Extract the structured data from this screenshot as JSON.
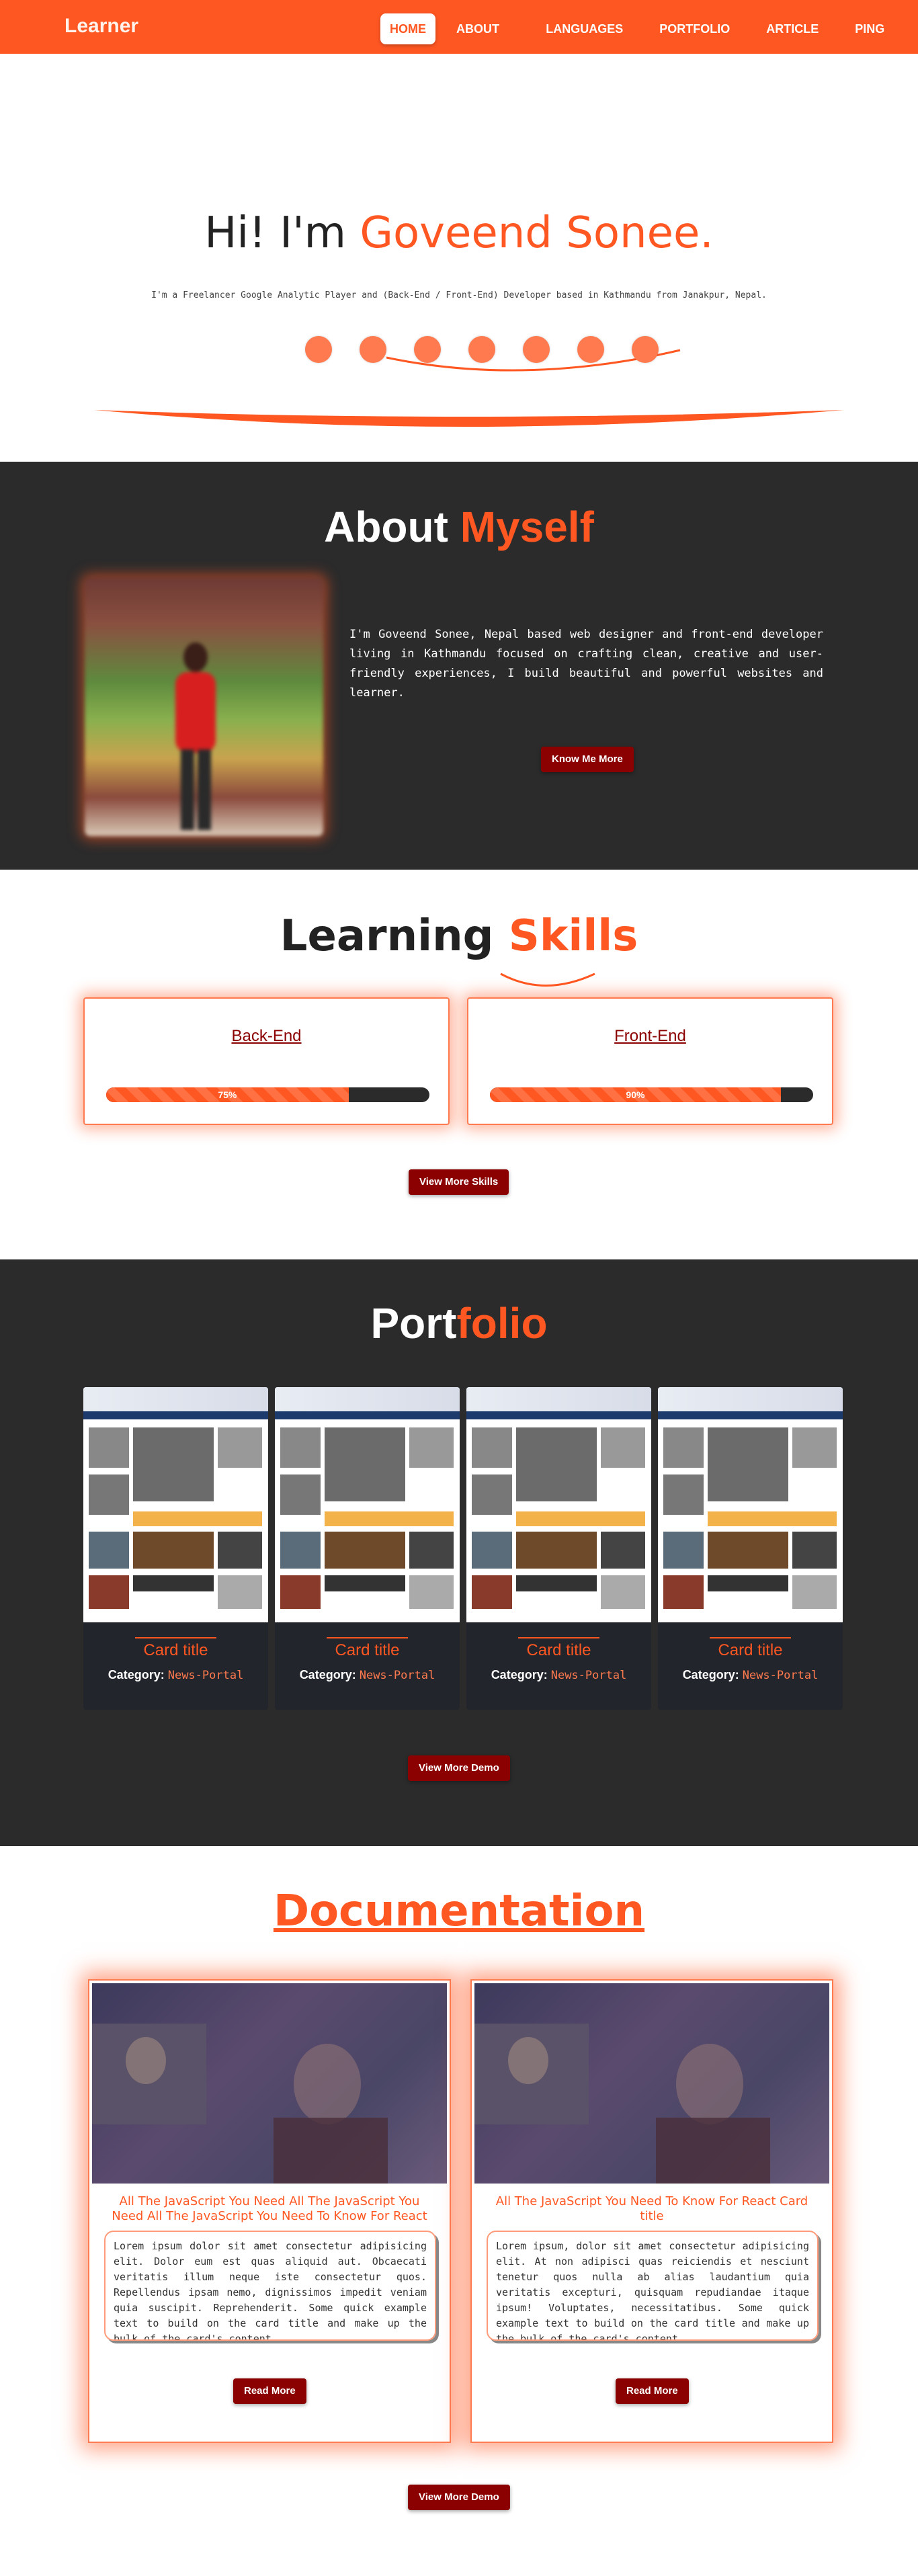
{
  "nav": {
    "brand": "Learner",
    "items": [
      {
        "label": "HOME",
        "active": true
      },
      {
        "label": "ABOUT ME",
        "active": false
      },
      {
        "label": "LANGUAGES",
        "active": false
      },
      {
        "label": "PORTFOLIO",
        "active": false
      },
      {
        "label": "ARTICLE",
        "active": false
      },
      {
        "label": "PING ME",
        "active": false
      }
    ]
  },
  "hero": {
    "greeting": "Hi! I'm ",
    "name": "Goveend Sonee.",
    "subtitle": "I'm a Freelancer Google Analytic Player and (Back-End / Front-End) Developer based in Kathmandu from Janakpur, Nepal."
  },
  "about": {
    "title_plain": "About ",
    "title_highlight": "Myself",
    "text": "I'm Goveend Sonee, Nepal based web designer and front-end developer living in Kathmandu focused on crafting clean, creative and user-friendly experiences, I build beautiful and powerful websites and learner.",
    "button": "Know Me More"
  },
  "skills": {
    "title_plain": "Learning ",
    "title_highlight": "Skills",
    "items": [
      {
        "name": "Back-End",
        "percent_label": "75%",
        "percent": 75
      },
      {
        "name": "Front-End",
        "percent_label": "90%",
        "percent": 90
      }
    ],
    "button": "View More Skills"
  },
  "portfolio": {
    "title_plain": "Port",
    "title_highlight": "folio",
    "cards": [
      {
        "title": "Card title",
        "category_label": "Category:",
        "category": "News-Portal"
      },
      {
        "title": "Card title",
        "category_label": "Category:",
        "category": "News-Portal"
      },
      {
        "title": "Card title",
        "category_label": "Category:",
        "category": "News-Portal"
      },
      {
        "title": "Card title",
        "category_label": "Category:",
        "category": "News-Portal"
      }
    ],
    "button": "View More Demo"
  },
  "docs": {
    "title": "Documentation",
    "cards": [
      {
        "heading": "All The JavaScript You Need All The JavaScript You Need All The JavaScript You Need To Know For React",
        "body": "Lorem ipsum dolor sit amet consectetur adipisicing elit. Dolor eum est quas aliquid aut. Obcaecati veritatis illum neque iste consectetur quos. Repellendus ipsam nemo, dignissimos impedit veniam quia suscipit. Reprehenderit. Some quick example text to build on the card title and make up the bulk of the card's content.",
        "button": "Read More"
      },
      {
        "heading": "All The JavaScript You Need To Know For React Card title",
        "body": "Lorem ipsum, dolor sit amet consectetur adipisicing elit. At non adipisci quas reiciendis et nesciunt tenetur quos nulla ab alias laudantium quia veritatis excepturi, quisquam repudiandae itaque ipsum! Voluptates, necessitatibus. Some quick example text to build on the card title and make up the bulk of the card's content.",
        "button": "Read More"
      }
    ],
    "button": "View More Demo"
  },
  "colors": {
    "accent": "#ff5722",
    "dark": "#2b2b2b",
    "button": "#8b0000"
  }
}
